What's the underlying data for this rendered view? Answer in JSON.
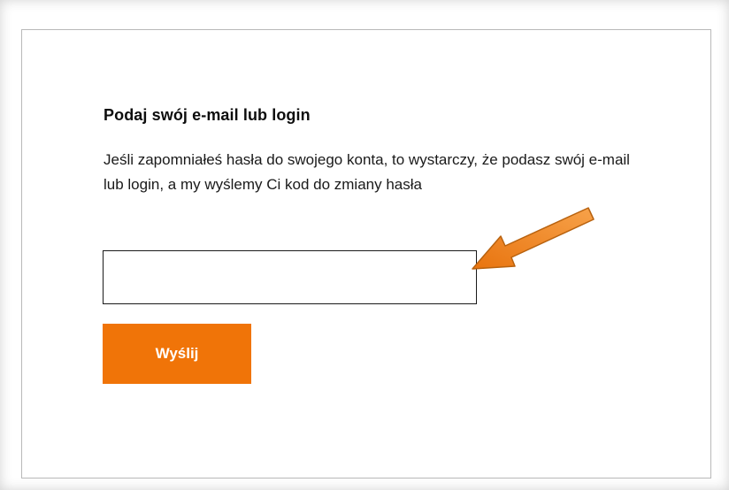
{
  "form": {
    "title": "Podaj swój e-mail lub login",
    "description": "Jeśli zapomniałeś hasła do swojego konta, to wystarczy, że podasz swój e-mail lub login, a my wyślemy Ci kod do zmiany hasła",
    "email_input": {
      "value": "",
      "placeholder": ""
    },
    "submit_label": "Wyślij"
  },
  "colors": {
    "accent": "#f07408",
    "arrow_fill": "#f28c28",
    "arrow_stroke": "#b8620f",
    "card_border": "#b9b9b9",
    "text": "#111111"
  },
  "icons": {
    "annotation": "orange-arrow-icon"
  }
}
